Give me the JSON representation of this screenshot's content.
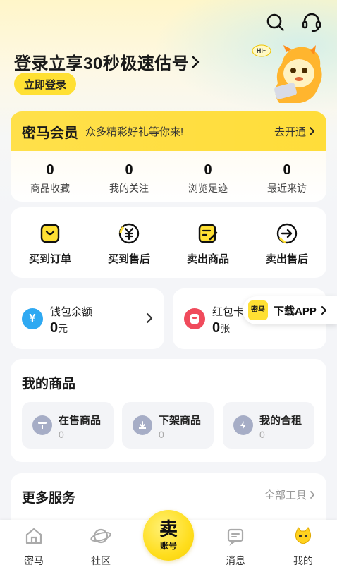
{
  "header": {
    "login_title": "登录立享30秒极速估号",
    "login_button": "立即登录",
    "mascot_bubble": "Hi~",
    "search_icon": "search-icon",
    "service_icon": "headset-icon"
  },
  "member": {
    "title": "密马会员",
    "subtitle": "众多精彩好礼等你来!",
    "open_label": "去开通"
  },
  "stats": [
    {
      "value": "0",
      "label": "商品收藏"
    },
    {
      "value": "0",
      "label": "我的关注"
    },
    {
      "value": "0",
      "label": "浏览足迹"
    },
    {
      "value": "0",
      "label": "最近来访"
    }
  ],
  "orders": [
    {
      "label": "买到订单",
      "icon": "bag-icon"
    },
    {
      "label": "买到售后",
      "icon": "yen-icon"
    },
    {
      "label": "卖出商品",
      "icon": "edit-doc-icon"
    },
    {
      "label": "卖出售后",
      "icon": "arrow-right-circle-icon"
    }
  ],
  "wallet": {
    "title": "钱包余额",
    "value": "0",
    "unit": "元"
  },
  "redpack": {
    "title": "红包卡",
    "value": "0",
    "unit": "张"
  },
  "download": {
    "logo_text": "密马",
    "label": "下载APP"
  },
  "goods": {
    "title": "我的商品",
    "items": [
      {
        "label": "在售商品",
        "value": "0"
      },
      {
        "label": "下架商品",
        "value": "0"
      },
      {
        "label": "我的合租",
        "value": "0"
      }
    ]
  },
  "more": {
    "title": "更多服务",
    "all_label": "全部工具"
  },
  "tabbar": {
    "tabs": [
      {
        "label": "密马"
      },
      {
        "label": "社区"
      },
      {
        "label": "消息"
      },
      {
        "label": "我的"
      }
    ],
    "sell_big": "卖",
    "sell_small": "账号"
  },
  "colors": {
    "brand_yellow": "#ffe033",
    "wallet_blue": "#2fa9f2",
    "redpack_red": "#f04b5c",
    "goods_icon": "#a6adc6"
  }
}
